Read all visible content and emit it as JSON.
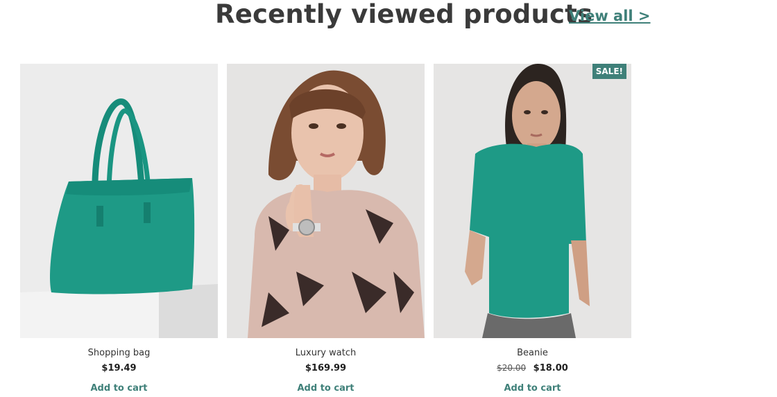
{
  "header": {
    "title": "Recently viewed products",
    "view_all": "View all >"
  },
  "colors": {
    "accent": "#3f8079",
    "product_teal": "#1e9a86"
  },
  "products": [
    {
      "name": "Shopping bag",
      "price": "$19.49",
      "old_price": "",
      "sale_badge": "",
      "add_to_cart": "Add to cart",
      "image_icon": "bag-image"
    },
    {
      "name": "Luxury watch",
      "price": "$169.99",
      "old_price": "",
      "sale_badge": "",
      "add_to_cart": "Add to cart",
      "image_icon": "watch-model-image"
    },
    {
      "name": "Beanie",
      "price": "$18.00",
      "old_price": "$20.00",
      "sale_badge": "SALE!",
      "add_to_cart": "Add to cart",
      "image_icon": "tshirt-model-image"
    }
  ]
}
